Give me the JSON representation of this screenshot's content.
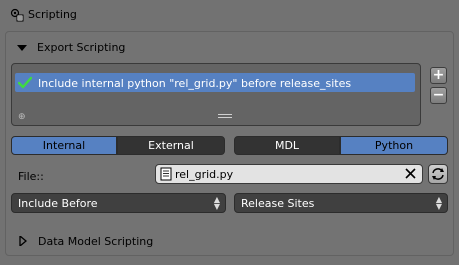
{
  "header": {
    "title": "Scripting"
  },
  "export_panel": {
    "title": "Export Scripting",
    "list": {
      "items": [
        {
          "label": "Include internal python \"rel_grid.py\" before release_sites",
          "checked": true
        }
      ]
    },
    "side_buttons": {
      "add": "+",
      "remove": "−"
    },
    "source_tabs": [
      {
        "label": "Internal",
        "active": true
      },
      {
        "label": "External",
        "active": false
      }
    ],
    "lang_tabs": [
      {
        "label": "MDL",
        "active": false
      },
      {
        "label": "Python",
        "active": true
      }
    ],
    "file": {
      "label": "File::",
      "value": "rel_grid.py"
    },
    "include_where": {
      "selected": "Include Before"
    },
    "include_target": {
      "selected": "Release Sites"
    }
  },
  "data_model_panel": {
    "title": "Data Model Scripting",
    "collapsed": true
  },
  "colors": {
    "background": "#727272",
    "selection_blue": "#5681c2",
    "dark_button": "#333333",
    "field_bg": "#e3e3e3"
  },
  "icons": [
    "scripting-icon",
    "triangle-down-icon",
    "checkmark-icon",
    "plus-icon",
    "minus-icon",
    "text-file-icon",
    "close-icon",
    "reload-icon",
    "triangle-right-icon"
  ]
}
